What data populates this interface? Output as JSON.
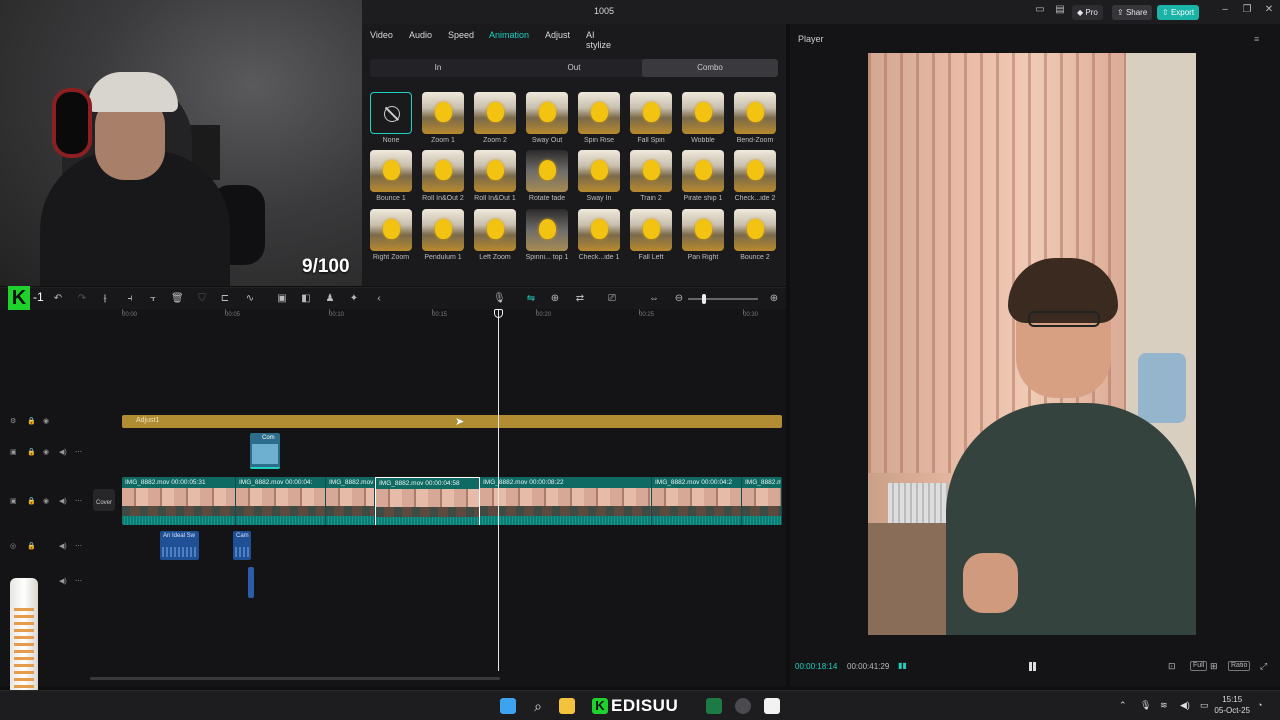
{
  "webcam": {
    "counter": "9/100"
  },
  "window": {
    "title": "1005",
    "pro_label": "Pro",
    "share_label": "Share",
    "export_label": "Export"
  },
  "effects": {
    "tabs": [
      "Video",
      "Audio",
      "Speed",
      "Animation",
      "Adjust",
      "AI stylize"
    ],
    "active_tab": "Animation",
    "subtabs": [
      "In",
      "Out",
      "Combo"
    ],
    "active_subtab": "Combo",
    "animations": [
      "None",
      "Zoom 1",
      "Zoom 2",
      "Sway Out",
      "Spin Rise",
      "Fall Spin",
      "Wobble",
      "Bend-Zoom",
      "Bounce 1",
      "Roll In&Out 2",
      "Roll In&Out 1",
      "Rotate fade",
      "Sway In",
      "Train 2",
      "Pirate ship 1",
      "Check...ide 2",
      "Right Zoom",
      "Pendulum 1",
      "Left Zoom",
      "Spinni... top 1",
      "Check...ide 1",
      "Fall Left",
      "Pan Right",
      "Bounce 2"
    ]
  },
  "player": {
    "title": "Player",
    "current_time": "00:00:18:14",
    "total_time": "00:00:41:29",
    "full_label": "Full",
    "ratio_label": "Ratio"
  },
  "timeline": {
    "ruler_ticks": [
      "00:00",
      "00:05",
      "00:10",
      "00:15",
      "00:20",
      "00:25",
      "00:30"
    ],
    "adjust_label": "Adjust1",
    "comp_label": "Com",
    "cover_label": "Cover",
    "clips": [
      "IMG_8882.mov   00:00:05:31",
      "IMG_8882.mov   00:00:04:",
      "IMG_8882.mov",
      "IMG_8882.mov   00:00:04:58",
      "IMG_8882.mov   00:00:08:22",
      "IMG_8882.mov   00:00:04:2",
      "IMG_8882.m"
    ],
    "audio_clips": [
      "An Ideal Sw",
      "Cam"
    ]
  },
  "taskbar": {
    "brand": "EDISUU",
    "time": "15:15",
    "date": "05-Oct-25"
  },
  "colors": {
    "accent": "#1fd1c1",
    "adjust": "#b08c33",
    "video_track": "#0c6e68",
    "audio_track": "#1f4f94"
  }
}
